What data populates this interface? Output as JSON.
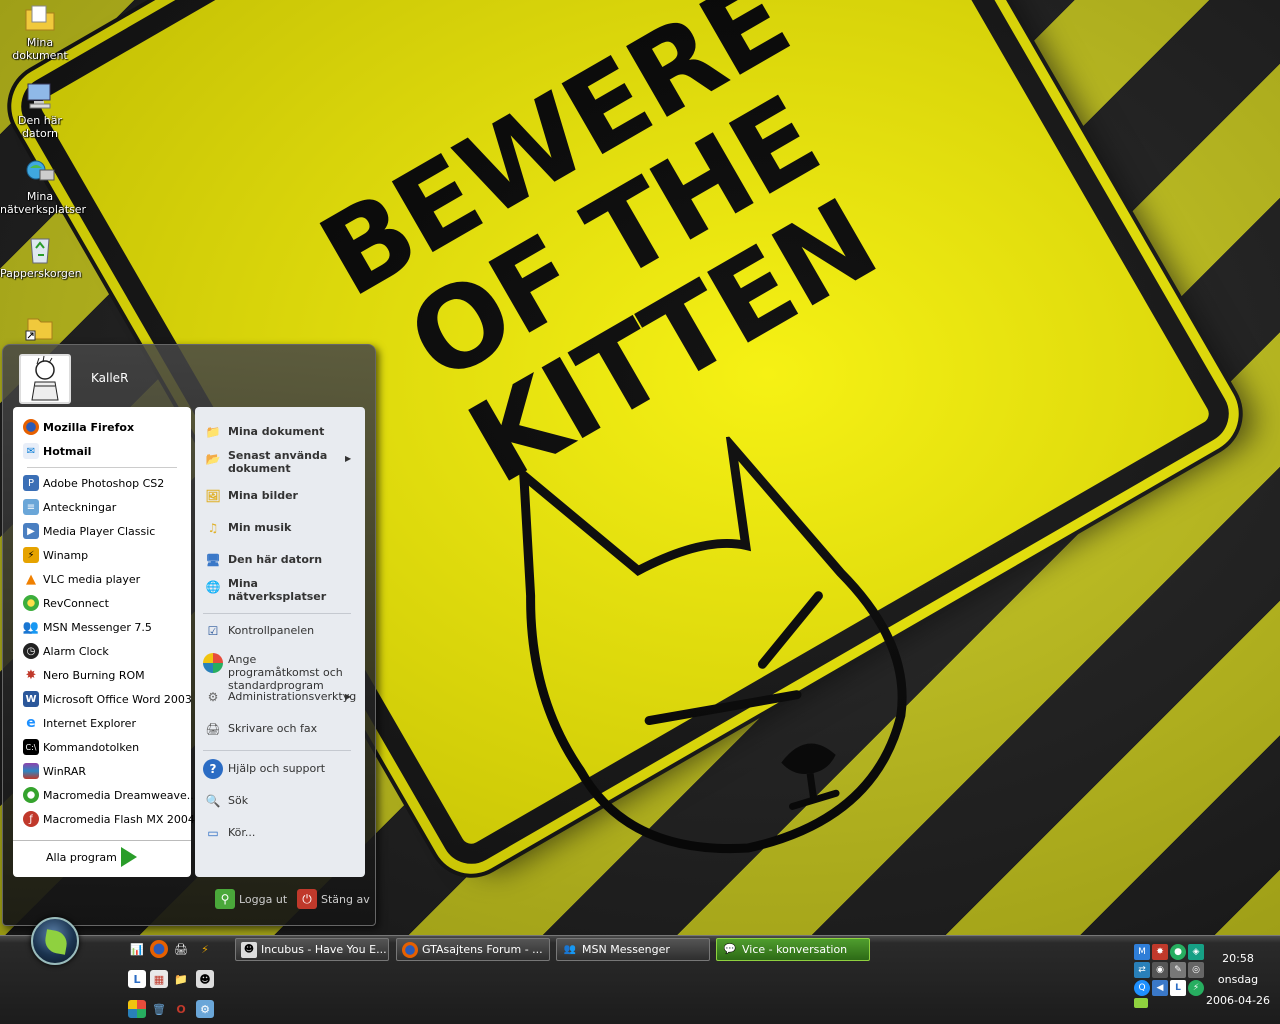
{
  "desktop": {
    "icons": [
      {
        "label": "Mina dokument",
        "icon": "folder-documents-icon"
      },
      {
        "label": "Den här datorn",
        "icon": "computer-icon"
      },
      {
        "label": "Mina nätverksplatser",
        "icon": "network-places-icon"
      },
      {
        "label": "Papperskorgen",
        "icon": "recycle-bin-icon"
      },
      {
        "label": "",
        "icon": "folder-shortcut-icon"
      }
    ],
    "wallpaper_text": [
      "BEWERE",
      "OF THE",
      "KITTEN"
    ]
  },
  "start_menu": {
    "user": "KalleR",
    "pinned": [
      {
        "label": "Mozilla Firefox",
        "icon": "firefox-icon",
        "color": "#e66000"
      },
      {
        "label": "Hotmail",
        "icon": "hotmail-icon",
        "color": "#0078d4"
      }
    ],
    "recent": [
      {
        "label": "Adobe Photoshop CS2",
        "icon": "photoshop-icon",
        "color": "#3b6fb6"
      },
      {
        "label": "Anteckningar",
        "icon": "notepad-icon",
        "color": "#6aa6d8"
      },
      {
        "label": "Media Player Classic",
        "icon": "media-player-icon",
        "color": "#4a7fc1"
      },
      {
        "label": "Winamp",
        "icon": "winamp-icon",
        "color": "#e6a300"
      },
      {
        "label": "VLC media player",
        "icon": "vlc-icon",
        "color": "#f08000"
      },
      {
        "label": "RevConnect",
        "icon": "revconnect-icon",
        "color": "#3cae3c"
      },
      {
        "label": "MSN Messenger 7.5",
        "icon": "msn-icon",
        "color": "#2f7ed8"
      },
      {
        "label": "Alarm Clock",
        "icon": "alarm-clock-icon",
        "color": "#222222"
      },
      {
        "label": "Nero Burning ROM",
        "icon": "nero-icon",
        "color": "#c0392b"
      },
      {
        "label": "Microsoft Office Word 2003",
        "icon": "word-icon",
        "color": "#2b579a"
      },
      {
        "label": "Internet Explorer",
        "icon": "ie-icon",
        "color": "#1e90ff"
      },
      {
        "label": "Kommandotolken",
        "icon": "cmd-icon",
        "color": "#000000"
      },
      {
        "label": "WinRAR",
        "icon": "winrar-icon",
        "color": "#8e44ad"
      },
      {
        "label": "Macromedia Dreamweave...",
        "icon": "dreamweaver-icon",
        "color": "#35a32d"
      },
      {
        "label": "Macromedia Flash MX 2004",
        "icon": "flash-icon",
        "color": "#c0392b"
      }
    ],
    "all_programs": "Alla program",
    "right": {
      "group1": [
        {
          "label": "Mina dokument",
          "icon": "folder-documents-icon",
          "submenu": false
        },
        {
          "label": "Senast använda dokument",
          "icon": "recent-documents-icon",
          "submenu": true
        },
        {
          "label": "Mina bilder",
          "icon": "my-pictures-icon",
          "submenu": false
        },
        {
          "label": "Min musik",
          "icon": "my-music-icon",
          "submenu": false
        },
        {
          "label": "Den här datorn",
          "icon": "computer-icon",
          "submenu": false
        },
        {
          "label": "Mina nätverksplatser",
          "icon": "network-places-icon",
          "submenu": false
        }
      ],
      "group2": [
        {
          "label": "Kontrollpanelen",
          "icon": "control-panel-icon",
          "submenu": false
        },
        {
          "label": "Ange programåtkomst och standardprogram",
          "icon": "program-access-icon",
          "submenu": false
        },
        {
          "label": "Administrationsverktyg",
          "icon": "admin-tools-icon",
          "submenu": true
        },
        {
          "label": "Skrivare och fax",
          "icon": "printer-icon",
          "submenu": false
        }
      ],
      "group3": [
        {
          "label": "Hjälp och support",
          "icon": "help-icon",
          "submenu": false
        },
        {
          "label": "Sök",
          "icon": "search-icon",
          "submenu": false
        },
        {
          "label": "Kör...",
          "icon": "run-icon",
          "submenu": false
        }
      ]
    },
    "logoff": "Logga ut",
    "shutdown": "Stäng av"
  },
  "taskbar": {
    "buttons": [
      {
        "label": "Incubus - Have You E...",
        "icon": "alien-icon",
        "active": false
      },
      {
        "label": "GTAsajtens Forum - ...",
        "icon": "firefox-icon",
        "active": false
      },
      {
        "label": "MSN Messenger",
        "icon": "msn-icon",
        "active": false
      },
      {
        "label": "Vice - konversation",
        "icon": "chat-icon",
        "active": true
      }
    ],
    "clock": {
      "time": "20:58",
      "day": "onsdag",
      "date": "2006-04-26"
    }
  }
}
